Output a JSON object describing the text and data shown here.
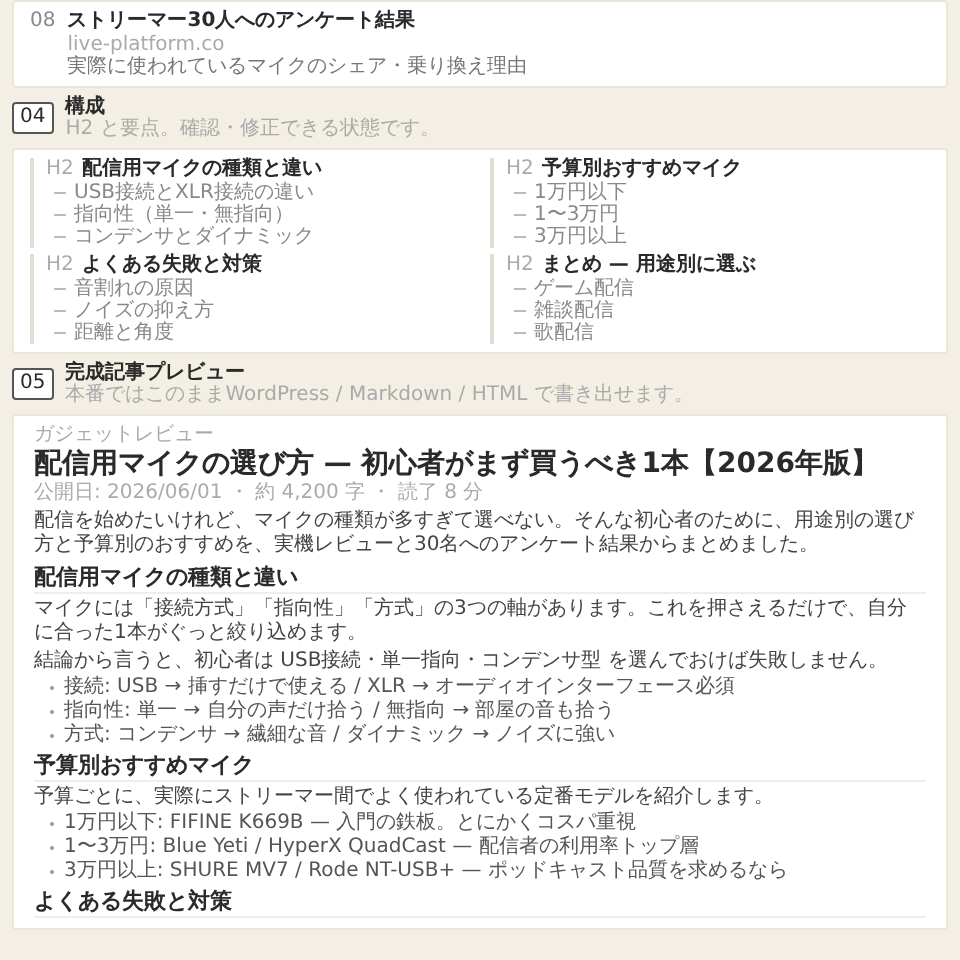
{
  "source_card": {
    "number": "08",
    "title": "ストリーマー30人へのアンケート結果",
    "url": "live-platform.co",
    "description": "実際に使われているマイクのシェア・乗り換え理由"
  },
  "outline_section": {
    "number": "04",
    "title": "構成",
    "subtitle": "H2 と要点。確認・修正できる状態です。",
    "groups": [
      {
        "marker": "H2",
        "heading": "配信用マイクの種類と違い",
        "items": [
          "USB接続とXLR接続の違い",
          "指向性（単一・無指向）",
          "コンデンサとダイナミック"
        ]
      },
      {
        "marker": "H2",
        "heading": "予算別おすすめマイク",
        "items": [
          "1万円以下",
          "1〜3万円",
          "3万円以上"
        ]
      },
      {
        "marker": "H2",
        "heading": "よくある失敗と対策",
        "items": [
          "音割れの原因",
          "ノイズの抑え方",
          "距離と角度"
        ]
      },
      {
        "marker": "H2",
        "heading": "まとめ — 用途別に選ぶ",
        "items": [
          "ゲーム配信",
          "雑談配信",
          "歌配信"
        ]
      }
    ]
  },
  "preview_section": {
    "number": "05",
    "title": "完成記事プレビュー",
    "subtitle": "本番ではこのままWordPress / Markdown / HTML で書き出せます。",
    "article": {
      "kicker": "ガジェットレビュー",
      "title": "配信用マイクの選び方 — 初心者がまず買うべき1本【2026年版】",
      "meta": "公開日: 2026/06/01 ・ 約 4,200 字 ・ 読了 8 分",
      "blocks": [
        {
          "kind": "paragraph",
          "text": "配信を始めたいけれど、マイクの種類が多すぎて選べない。そんな初心者のために、用途別の選び方と予算別のおすすめを、実機レビューと30名へのアンケート結果からまとめました。"
        },
        {
          "kind": "heading",
          "text": "配信用マイクの種類と違い"
        },
        {
          "kind": "paragraph",
          "text": "マイクには「接続方式」「指向性」「方式」の3つの軸があります。これを押さえるだけで、自分に合った1本がぐっと絞り込めます。"
        },
        {
          "kind": "paragraph",
          "text": "結論から言うと、初心者は USB接続・単一指向・コンデンサ型 を選んでおけば失敗しません。"
        },
        {
          "kind": "list",
          "items": [
            "接続: USB → 挿すだけで使える / XLR → オーディオインターフェース必須",
            "指向性: 単一 → 自分の声だけ拾う / 無指向 → 部屋の音も拾う",
            "方式: コンデンサ → 繊細な音 / ダイナミック → ノイズに強い"
          ]
        },
        {
          "kind": "heading",
          "text": "予算別おすすめマイク"
        },
        {
          "kind": "paragraph",
          "text": "予算ごとに、実際にストリーマー間でよく使われている定番モデルを紹介します。"
        },
        {
          "kind": "list",
          "items": [
            "1万円以下: FIFINE K669B — 入門の鉄板。とにかくコスパ重視",
            "1〜3万円: Blue Yeti / HyperX QuadCast — 配信者の利用率トップ層",
            "3万円以上: SHURE MV7 / Rode NT-USB+ — ポッドキャスト品質を求めるなら"
          ]
        },
        {
          "kind": "heading",
          "text": "よくある失敗と対策"
        }
      ]
    }
  }
}
